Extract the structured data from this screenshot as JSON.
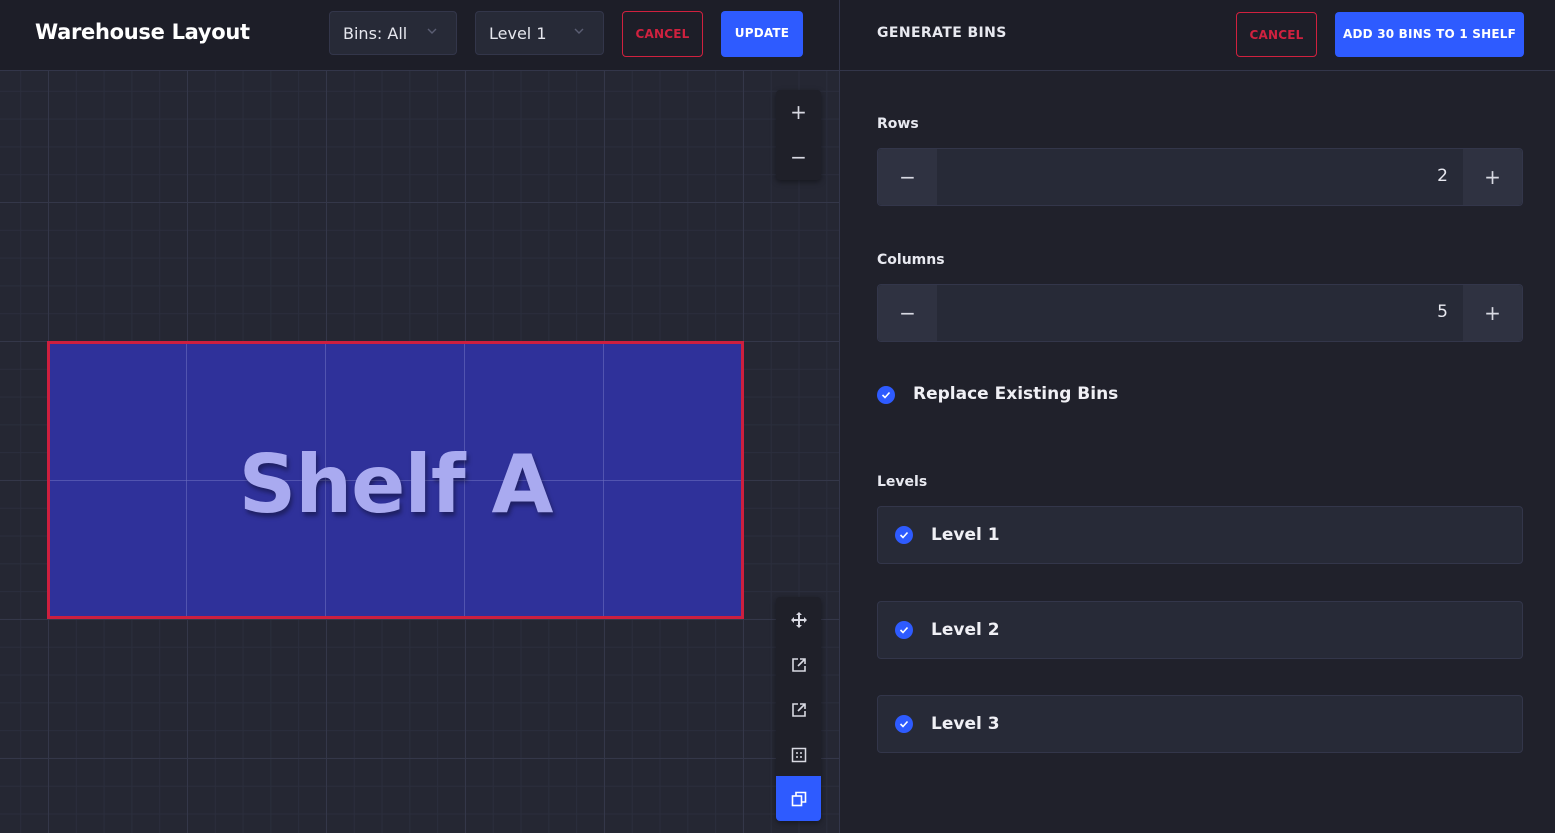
{
  "header": {
    "title": "Warehouse Layout",
    "bins_filter": "Bins: All",
    "level_filter": "Level 1",
    "cancel_label": "CANCEL",
    "update_label": "UPDATE"
  },
  "canvas": {
    "shelf_label": "Shelf A",
    "zoom_in": "+",
    "zoom_out": "−",
    "tools": [
      "move-icon",
      "external-link-icon",
      "external-link-icon",
      "grid-icon",
      "copy-icon"
    ]
  },
  "panel": {
    "title": "GENERATE BINS",
    "cancel_label": "CANCEL",
    "submit_label": "ADD 30 BINS TO 1 SHELF",
    "rows": {
      "label": "Rows",
      "value": "2",
      "minus": "−",
      "plus": "+"
    },
    "columns": {
      "label": "Columns",
      "value": "5",
      "minus": "−",
      "plus": "+"
    },
    "replace_label": "Replace Existing Bins",
    "levels_label": "Levels",
    "levels": [
      {
        "label": "Level 1",
        "checked": true
      },
      {
        "label": "Level 2",
        "checked": true
      },
      {
        "label": "Level 3",
        "checked": true
      }
    ]
  },
  "colors": {
    "accent": "#2e5bff",
    "danger": "#d0213f",
    "shelf_fill": "#2f319a",
    "shelf_border": "#cd1f3f"
  }
}
